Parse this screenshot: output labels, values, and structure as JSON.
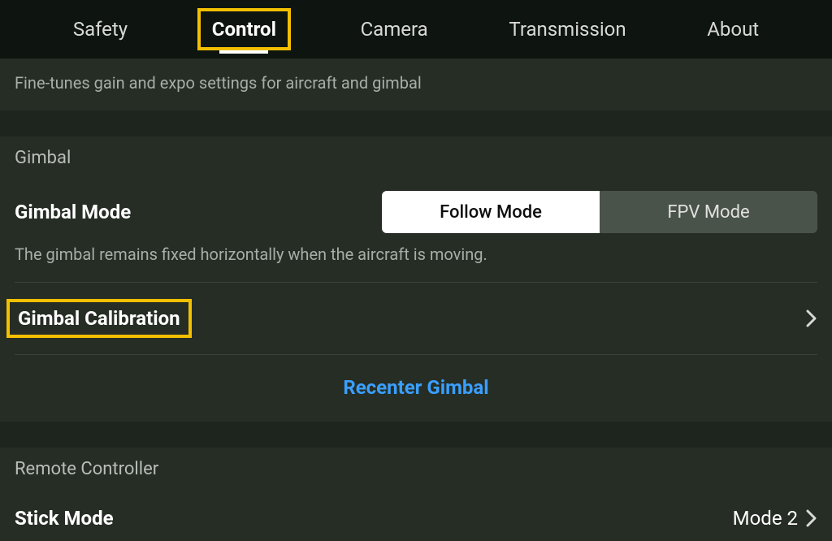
{
  "tabs": {
    "safety": "Safety",
    "control": "Control",
    "camera": "Camera",
    "transmission": "Transmission",
    "about": "About",
    "active": "control"
  },
  "description": "Fine-tunes gain and expo settings for aircraft and gimbal",
  "sections": {
    "gimbal": {
      "header": "Gimbal",
      "mode_label": "Gimbal Mode",
      "mode_options": {
        "follow": "Follow Mode",
        "fpv": "FPV Mode"
      },
      "mode_selected": "follow",
      "mode_help": "The gimbal remains fixed horizontally when the aircraft is moving.",
      "calibration_label": "Gimbal Calibration",
      "recenter_label": "Recenter Gimbal"
    },
    "remote": {
      "header": "Remote Controller",
      "stick_mode_label": "Stick Mode",
      "stick_mode_value": "Mode 2"
    }
  }
}
